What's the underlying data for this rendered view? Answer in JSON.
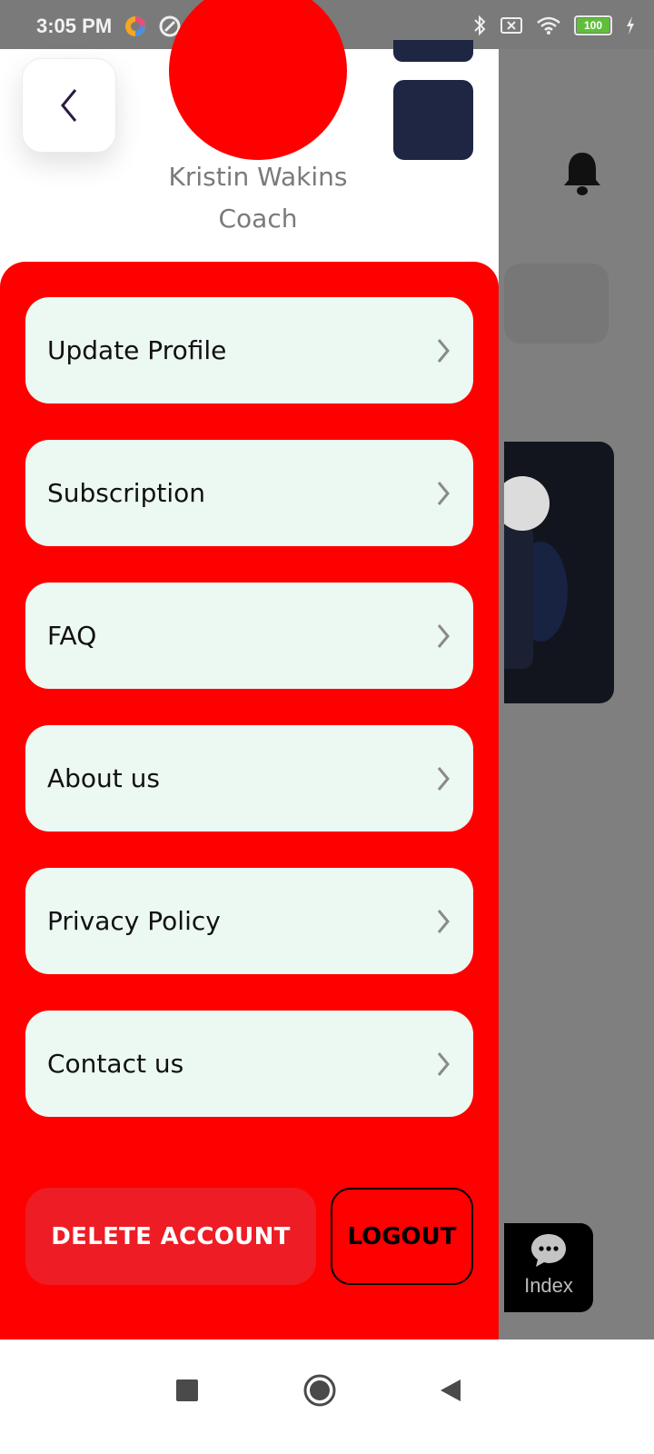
{
  "status_bar": {
    "time": "3:05 PM",
    "dots": "···",
    "battery": "100"
  },
  "drawer": {
    "user_name": "Kristin Wakins",
    "user_role": "Coach",
    "menu_items": [
      {
        "label": "Update Profile",
        "icon": "chevron-right-icon"
      },
      {
        "label": "Subscription",
        "icon": "chevron-right-icon"
      },
      {
        "label": "FAQ",
        "icon": "chevron-right-icon"
      },
      {
        "label": "About us",
        "icon": "chevron-right-icon"
      },
      {
        "label": "Privacy Policy",
        "icon": "chevron-right-icon"
      },
      {
        "label": "Contact us",
        "icon": "chevron-right-icon"
      }
    ],
    "delete_label": "DELETE ACCOUNT",
    "logout_label": "LOGOUT"
  },
  "background_app": {
    "index_tab_label": "Index"
  },
  "colors": {
    "panel": "#ff0000",
    "menu_item_bg": "#ecf8f2",
    "delete_bg": "#ee1c24",
    "accent_dark": "#1e2643"
  }
}
